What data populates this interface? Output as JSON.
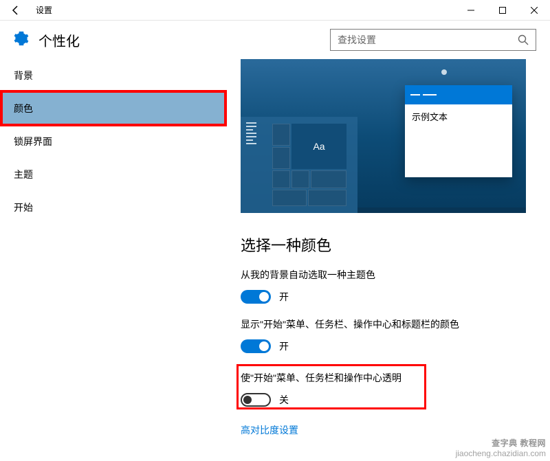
{
  "titlebar": {
    "title": "设置"
  },
  "header": {
    "title": "个性化",
    "search_placeholder": "查找设置"
  },
  "sidebar": {
    "items": [
      {
        "label": "背景"
      },
      {
        "label": "颜色"
      },
      {
        "label": "锁屏界面"
      },
      {
        "label": "主题"
      },
      {
        "label": "开始"
      }
    ]
  },
  "content": {
    "preview": {
      "sample_text": "示例文本",
      "tile_label": "Aa"
    },
    "section_title": "选择一种颜色",
    "toggle1": {
      "label": "从我的背景自动选取一种主题色",
      "state_text": "开"
    },
    "toggle2": {
      "label": "显示\"开始\"菜单、任务栏、操作中心和标题栏的颜色",
      "state_text": "开"
    },
    "toggle3": {
      "label": "使\"开始\"菜单、任务栏和操作中心透明",
      "state_text": "关"
    },
    "link": "高对比度设置"
  },
  "watermark": {
    "cn": "查字典 教程网",
    "en": "jiaocheng.chazidian.com"
  }
}
